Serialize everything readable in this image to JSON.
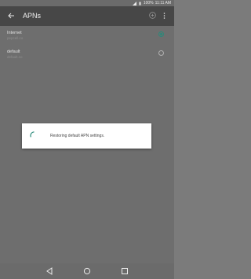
{
  "status_bar": {
    "battery": "100%",
    "time": "11:11 AM"
  },
  "app_bar": {
    "title": "APNs"
  },
  "apns": [
    {
      "name": "Internet",
      "subtitle": "pepcell.co",
      "selected": true
    },
    {
      "name": "default",
      "subtitle": "default.co",
      "selected": false
    }
  ],
  "dialog": {
    "message": "Restoring default APN settings."
  },
  "colors": {
    "accent": "#2a8a7a",
    "app_bar": "#474747",
    "content": "#6e6e6e"
  },
  "icons": [
    "back-arrow-icon",
    "add-icon",
    "more-vert-icon",
    "spinner-icon",
    "back-nav-icon",
    "home-nav-icon",
    "recents-nav-icon"
  ]
}
